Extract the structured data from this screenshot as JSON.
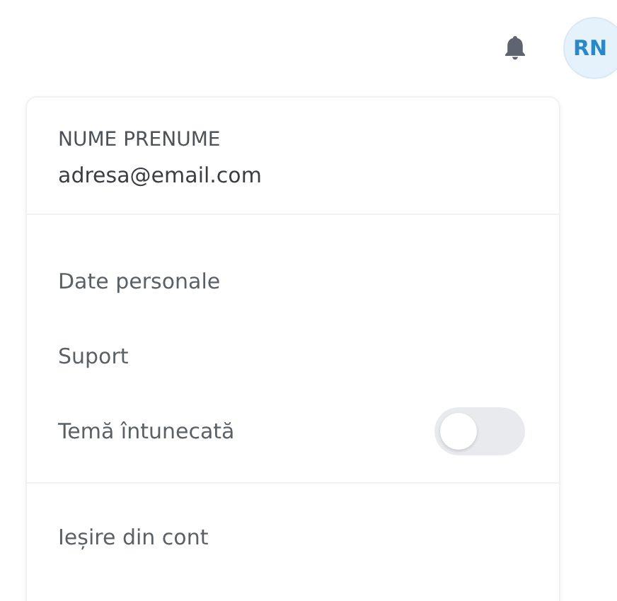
{
  "header": {
    "avatar_initials": "RN"
  },
  "account_menu": {
    "name": "NUME PRENUME",
    "email": "adresa@email.com",
    "items": [
      {
        "kind": "link",
        "label": "Date personale"
      },
      {
        "kind": "link",
        "label": "Suport"
      },
      {
        "kind": "toggle",
        "label": "Temă întunecată",
        "on": false
      }
    ],
    "logout": "Ieșire din cont"
  }
}
